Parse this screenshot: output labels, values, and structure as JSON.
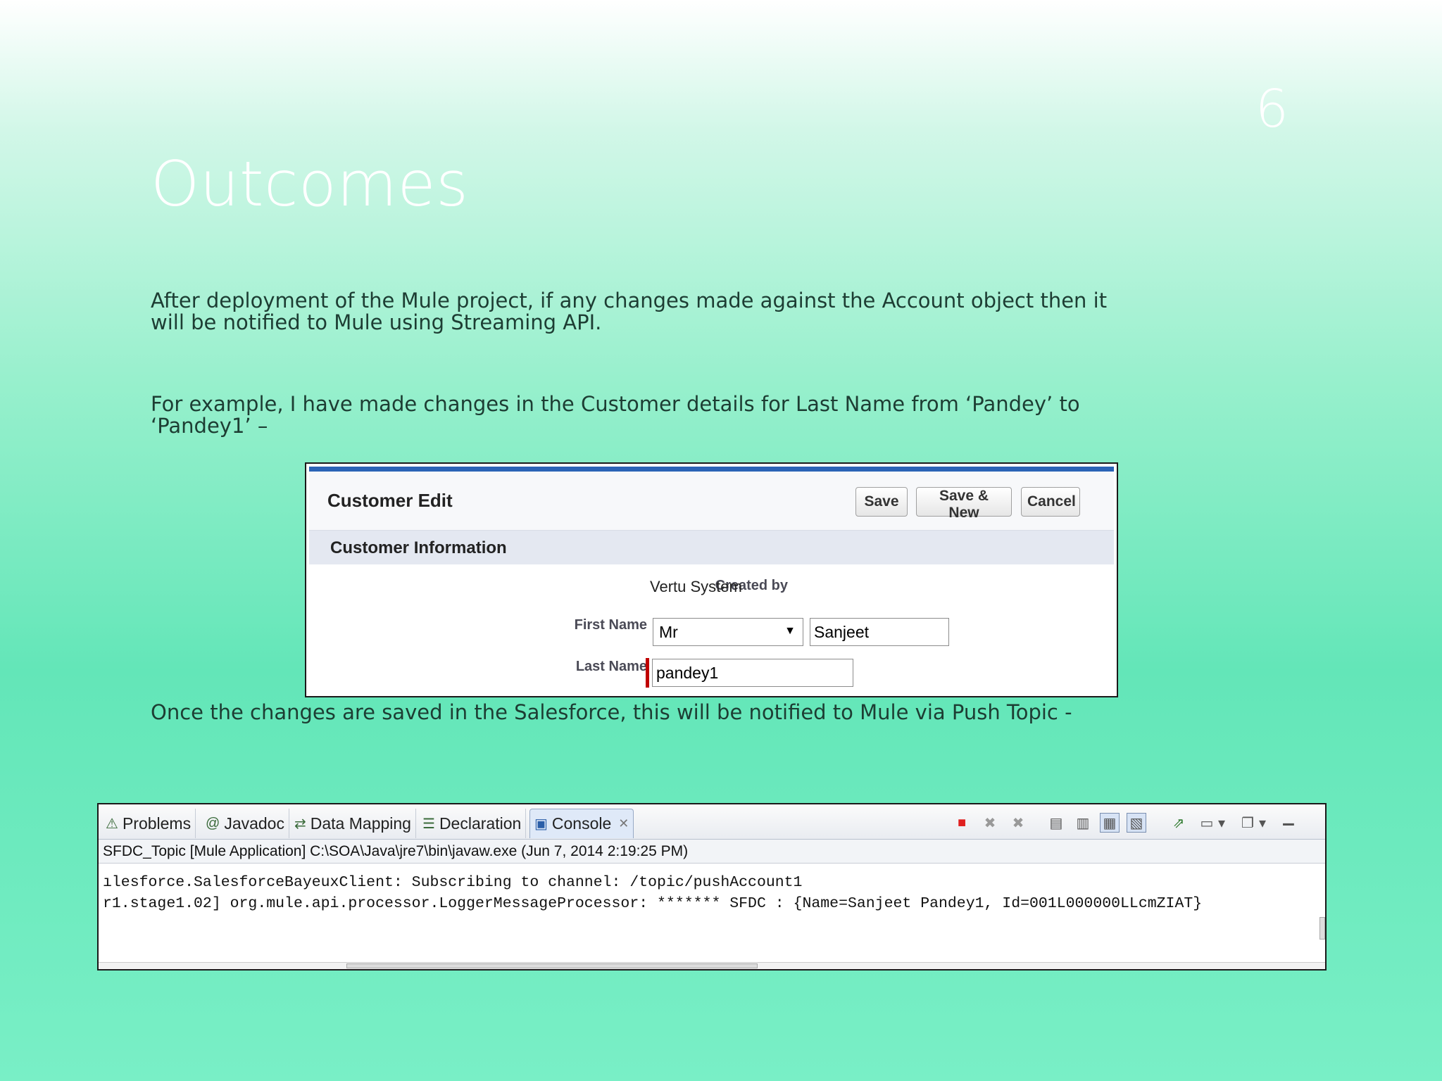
{
  "slide": {
    "number": "6",
    "title": "Outcomes",
    "para1": "After deployment of the Mule project, if any changes made against the Account object then it will be notified to Mule using Streaming API.",
    "para2": "For example, I have made changes in the Customer details for Last Name from ‘Pandey’ to ‘Pandey1’ –",
    "para3": "Once the changes are saved in the Salesforce, this will be notified to Mule via Push Topic  -"
  },
  "customer_edit": {
    "title": "Customer Edit",
    "buttons": {
      "save": "Save",
      "save_new": "Save & New",
      "cancel": "Cancel"
    },
    "section_title": "Customer Information",
    "created_by_label": "Created by",
    "created_by_value": "Vertu System",
    "first_name_label": "First Name",
    "salutation_value": "Mr",
    "first_name_value": "Sanjeet",
    "last_name_label": "Last Name",
    "last_name_value": "pandey1"
  },
  "console": {
    "tabs": [
      {
        "label": "Problems",
        "icon": "problems-icon"
      },
      {
        "label": "Javadoc",
        "icon": "javadoc-icon"
      },
      {
        "label": "Data Mapping",
        "icon": "data-mapping-icon"
      },
      {
        "label": "Declaration",
        "icon": "declaration-icon"
      },
      {
        "label": "Console",
        "icon": "console-icon"
      }
    ],
    "path": "SFDC_Topic [Mule Application] C:\\SOA\\Java\\jre7\\bin\\javaw.exe (Jun 7, 2014 2:19:25 PM)",
    "lines": [
      "ılesforce.SalesforceBayeuxClient: Subscribing to channel: /topic/pushAccount1",
      "r1.stage1.02] org.mule.api.processor.LoggerMessageProcessor: ******* SFDC : {Name=Sanjeet Pandey1, Id=001L000000LLcmZIAT}"
    ],
    "colors": {
      "terminate": "#e02020",
      "active_tab": "#dfe9f8"
    }
  }
}
